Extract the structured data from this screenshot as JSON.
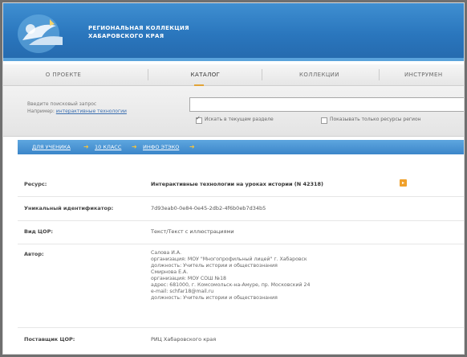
{
  "header": {
    "title_line1": "РЕГИОНАЛЬНАЯ КОЛЛЕКЦИЯ",
    "title_line2": "ХАБАРОВСКОГО КРАЯ",
    "logo_icon": "collection-logo-icon"
  },
  "nav": {
    "tabs": [
      {
        "label": "О ПРОЕКТЕ"
      },
      {
        "label": "КАТАЛОГ"
      },
      {
        "label": "КОЛЛЕКЦИИ"
      },
      {
        "label": "ИНСТРУМЕН"
      }
    ],
    "active": "КАТАЛОГ"
  },
  "search": {
    "prompt": "Введите поисковый запрос",
    "example_prefix": "Например:",
    "example_link": "интерактивные технологии",
    "input_value": "",
    "option1_label": "Искать в текущем разделе",
    "option1_checked": true,
    "option2_label": "Показывать только ресурсы регион",
    "option2_checked": false
  },
  "breadcrumb": {
    "items": [
      "ДЛЯ УЧЕНИКА",
      "10 КЛАСС",
      "ИНФО ЭТЭКО"
    ],
    "separator_icon": "arrow-right-icon"
  },
  "record": {
    "resource_label": "Ресурс:",
    "resource_value": "Интерактивные технологии на уроках истории (N 42318)",
    "id_label": "Уникальный идентификатор:",
    "id_value": "7d93eab0-0e84-0e45-2db2-4f6b0eb7d34b5",
    "type_label": "Вид ЦОР:",
    "type_value": "Текст/Текст с иллюстрациями",
    "author_label": "Автор:",
    "author_lines": [
      "Салова И.А.",
      "организация: МОУ \"Многопрофильный лицей\" г. Хабаровск",
      "должность: Учитель истории и обществознания",
      "Смирнова Е.А.",
      "организация: МОУ СОШ №18",
      "адрес: 681000, г. Комсомольск-на-Амуре, пр. Московский 24",
      "e-mail: schfar18@mail.ru",
      "должность: Учитель истории и обществознания"
    ],
    "supplier_label": "Поставщик ЦОР:",
    "supplier_value": "РИЦ Хабаровского края"
  },
  "colors": {
    "banner": "#2a76bd",
    "crumb_bar": "#3b86c9",
    "accent": "#f0a12c"
  }
}
